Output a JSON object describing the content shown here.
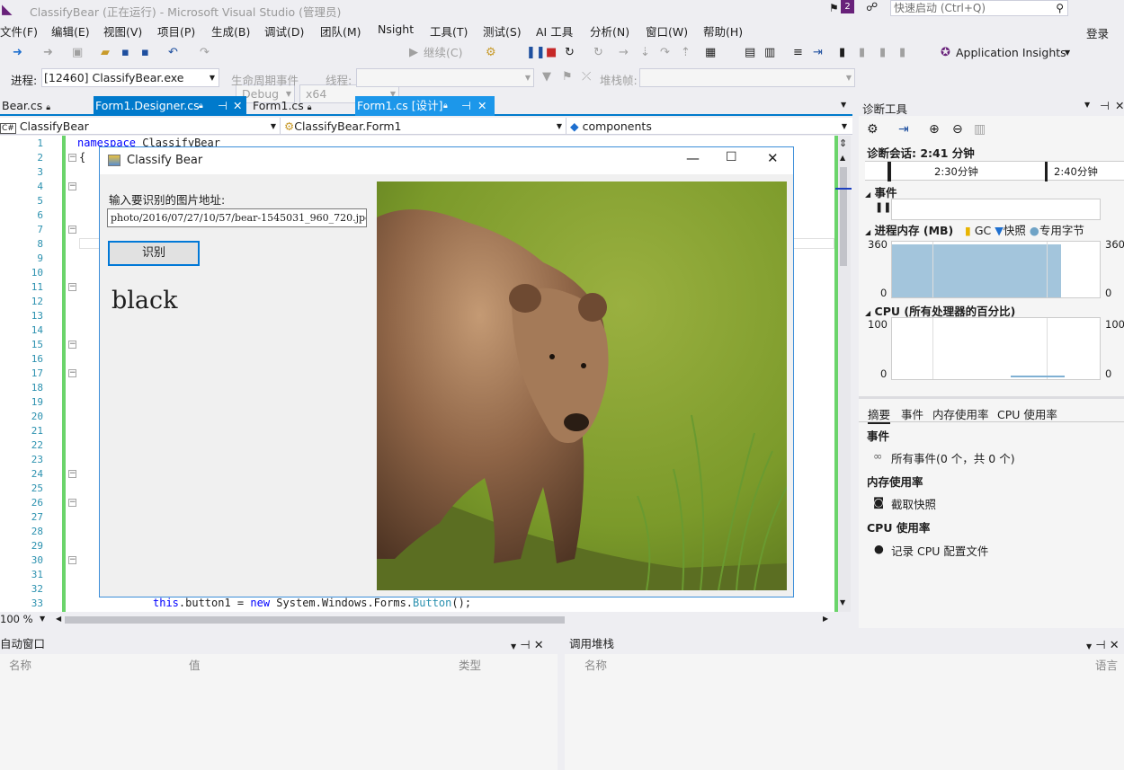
{
  "window": {
    "title": "ClassifyBear (正在运行) - Microsoft Visual Studio (管理员)",
    "notification_count": "2",
    "quick_launch_placeholder": "快速启动 (Ctrl+Q)",
    "sign_in": "登录"
  },
  "menu": [
    "文件(F)",
    "编辑(E)",
    "视图(V)",
    "项目(P)",
    "生成(B)",
    "调试(D)",
    "团队(M)",
    "Nsight",
    "工具(T)",
    "测试(S)",
    "AI 工具",
    "分析(N)",
    "窗口(W)",
    "帮助(H)"
  ],
  "toolbar": {
    "config": "Debug",
    "platform": "x64",
    "continue_label": "继续(C)",
    "app_insights": "Application Insights"
  },
  "debug_toolbar": {
    "process_label": "进程:",
    "process_value": "[12460] ClassifyBear.exe",
    "lifecycle_label": "生命周期事件",
    "thread_label": "线程:",
    "stack_label": "堆栈帧:"
  },
  "tabs": [
    {
      "label": "Bear.cs"
    },
    {
      "label": "Form1.Designer.cs"
    },
    {
      "label": "Form1.cs"
    },
    {
      "label": "Form1.cs [设计]"
    }
  ],
  "navbar": {
    "project": "ClassifyBear",
    "class": "ClassifyBear.Form1",
    "member": "components"
  },
  "editor": {
    "line_numbers": [
      "1",
      "2",
      "3",
      "4",
      "5",
      "6",
      "7",
      "8",
      "9",
      "10",
      "11",
      "12",
      "13",
      "14",
      "15",
      "16",
      "17",
      "18",
      "19",
      "20",
      "21",
      "22",
      "23",
      "24",
      "25",
      "26",
      "27",
      "28",
      "29",
      "30",
      "31",
      "32",
      "33"
    ],
    "code_line1_kw": "namespace",
    "code_line1_name": "ClassifyBear",
    "code_line2": "{",
    "code_line33_this": "this",
    "code_line33_mid": ".button1 = ",
    "code_line33_new": "new",
    "code_line33_ns": " System.Windows.Forms.",
    "code_line33_type": "Button",
    "code_line33_end": "();",
    "zoom": "100 %"
  },
  "form": {
    "title": "Classify Bear",
    "prompt": "输入要识别的图片地址:",
    "path": "photo/2016/07/27/10/57/bear-1545031_960_720.jpg",
    "button": "识别",
    "result": "black"
  },
  "diagnostics": {
    "title": "诊断工具",
    "session": "诊断会话: 2:41 分钟",
    "time_marks": [
      "2:30分钟",
      "2:40分钟"
    ],
    "events_section": "事件",
    "memory_section": "进程内存 (MB)",
    "legend": {
      "gc": "GC",
      "snapshot": "快照",
      "private_bytes": "专用字节"
    },
    "memory_max": "360",
    "memory_min": "0",
    "memory_fill_fraction": 0.95,
    "cpu_section": "CPU (所有处理器的百分比)",
    "cpu_max": "100",
    "cpu_min": "0",
    "summary_tabs": [
      "摘要",
      "事件",
      "内存使用率",
      "CPU 使用率"
    ],
    "events_heading": "事件",
    "all_events": "所有事件(0 个，共 0 个)",
    "memory_heading": "内存使用率",
    "take_snapshot": "截取快照",
    "cpu_heading": "CPU 使用率",
    "record_cpu": "记录 CPU 配置文件"
  },
  "autos": {
    "title": "自动窗口",
    "columns": [
      "名称",
      "值",
      "类型"
    ]
  },
  "callstack": {
    "title": "调用堆栈",
    "columns": [
      "名称",
      "语言"
    ]
  },
  "colors": {
    "accent": "#007acc",
    "vs_purple": "#68217a",
    "changed_bar": "#6bd46b",
    "memory_fill": "#a3c5dc"
  }
}
